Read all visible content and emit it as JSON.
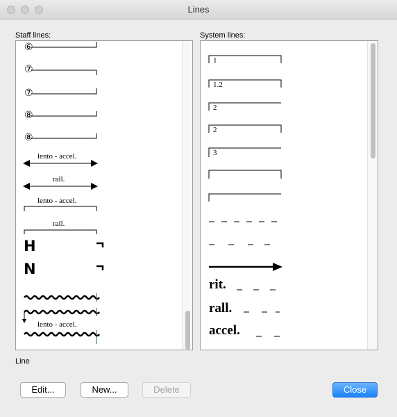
{
  "window": {
    "title": "Lines"
  },
  "staff_pane": {
    "label": "Staff lines:",
    "items": [
      {
        "glyph": "⑥",
        "kind": "bracket"
      },
      {
        "glyph": "⑦",
        "kind": "bracket"
      },
      {
        "glyph": "⑦",
        "kind": "bracket"
      },
      {
        "glyph": "⑧",
        "kind": "bracket"
      },
      {
        "glyph": "⑧",
        "kind": "bracket"
      },
      {
        "text": "lento - accel.",
        "kind": "double-arrow"
      },
      {
        "text": "rall.",
        "kind": "double-arrow"
      },
      {
        "text": "lento - accel.",
        "kind": "text-bracket"
      },
      {
        "text": "rall.",
        "kind": "text-bracket"
      },
      {
        "glyph": "H",
        "kind": "bold-bracket"
      },
      {
        "glyph": "N",
        "kind": "bold-bracket"
      },
      {
        "kind": "wavy"
      },
      {
        "kind": "wavy-arrow"
      },
      {
        "text": "lento - accel.",
        "kind": "wavy-text"
      }
    ],
    "scroll_position": 0.95
  },
  "system_pane": {
    "label": "System lines:",
    "items": [
      {
        "text": "1",
        "kind": "ending-bracket"
      },
      {
        "text": "1.2",
        "kind": "ending-bracket"
      },
      {
        "text": "2",
        "kind": "ending-open"
      },
      {
        "text": "2",
        "kind": "ending-bracket"
      },
      {
        "text": "3",
        "kind": "ending-open"
      },
      {
        "kind": "ending-plain-bracket"
      },
      {
        "kind": "ending-plain-open"
      },
      {
        "kind": "dashes"
      },
      {
        "kind": "wide-dashes"
      },
      {
        "kind": "arrow"
      },
      {
        "text": "rit.",
        "kind": "bold-dashes"
      },
      {
        "text": "rall.",
        "kind": "bold-dashes"
      },
      {
        "text": "accel.",
        "kind": "bold-dashes"
      }
    ],
    "scroll_position": 0.0
  },
  "selection": {
    "label": "Line"
  },
  "buttons": {
    "edit": "Edit...",
    "new": "New...",
    "delete": "Delete",
    "close": "Close"
  }
}
